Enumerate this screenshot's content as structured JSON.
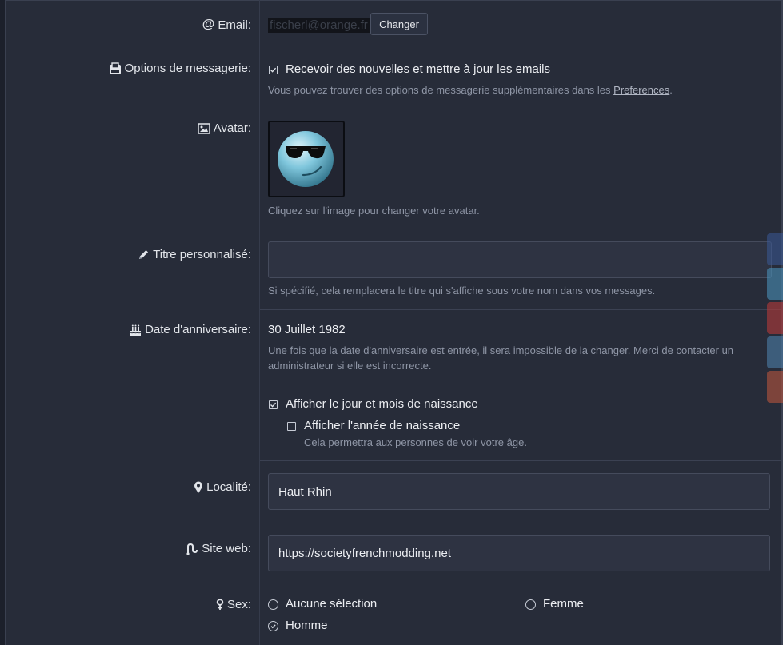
{
  "email": {
    "label": "Email:",
    "value": "fischerl@orange.fr",
    "change_button": "Changer"
  },
  "mail_options": {
    "label": "Options de messagerie:",
    "checkbox_label": "Recevoir des nouvelles et mettre à jour les emails",
    "checked": true,
    "hint_prefix": "Vous pouvez trouver des options de messagerie supplémentaires dans les",
    "hint_link": "Preferences",
    "hint_suffix": "."
  },
  "avatar": {
    "label": "Avatar:",
    "hint": "Cliquez sur l'image pour changer votre avatar."
  },
  "custom_title": {
    "label": "Titre personnalisé:",
    "value": "",
    "hint": "Si spécifié, cela remplacera le titre qui s'affiche sous votre nom dans vos messages."
  },
  "birthday": {
    "label": "Date d'anniversaire:",
    "value": "30 Juillet 1982",
    "hint_line1": "Une fois que la date d'anniversaire est entrée, il sera impossible de la changer. Merci de contacter un",
    "hint_line2": "administrateur si elle est incorrecte.",
    "show_day_month_label": "Afficher le jour et mois de naissance",
    "show_day_month_checked": true,
    "show_year_label": "Afficher l'année de naissance",
    "show_year_checked": false,
    "show_year_hint": "Cela permettra aux personnes de voir votre âge."
  },
  "location": {
    "label": "Localité:",
    "value": "Haut Rhin"
  },
  "website": {
    "label": "Site web:",
    "value": "https://societyfrenchmodding.net"
  },
  "sex": {
    "label": "Sex:",
    "options": [
      "Aucune sélection",
      "Femme",
      "Homme"
    ],
    "selected": "Homme"
  },
  "social_tabs": [
    {
      "name": "facebook",
      "color": "#3b5998"
    },
    {
      "name": "twitter",
      "color": "#4a90b8"
    },
    {
      "name": "youtube",
      "color": "#b53a3a"
    },
    {
      "name": "tumblr",
      "color": "#4d7ea8"
    },
    {
      "name": "reddit",
      "color": "#b8553d"
    }
  ]
}
